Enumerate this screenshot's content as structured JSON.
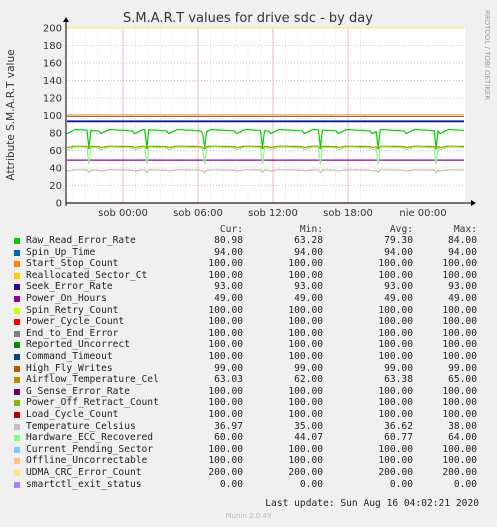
{
  "chart_data": {
    "type": "line",
    "title": "S.M.A.R.T values for drive sdc - by day",
    "ylabel": "Attribute S.M.A.R.T value",
    "side_label": "RRDTOOL / TOBI OETIKER",
    "ylim": [
      0,
      200
    ],
    "yticks": [
      "0",
      "20",
      "40",
      "60",
      "80",
      "100",
      "120",
      "140",
      "160",
      "180",
      "200"
    ],
    "xticks": [
      "sob 00:00",
      "sob 06:00",
      "sob 12:00",
      "sob 18:00",
      "nie 00:00"
    ],
    "grid": true,
    "legend_headers": [
      "Cur:",
      "Min:",
      "Avg:",
      "Max:"
    ],
    "series": [
      {
        "name": "Raw_Read_Error_Rate",
        "color": "#00cc00",
        "cur": "80.98",
        "min": "63.28",
        "avg": "79.30",
        "max": "84.00"
      },
      {
        "name": "Spin_Up_Time",
        "color": "#0066b3",
        "cur": "94.00",
        "min": "94.00",
        "avg": "94.00",
        "max": "94.00"
      },
      {
        "name": "Start_Stop_Count",
        "color": "#ff8000",
        "cur": "100.00",
        "min": "100.00",
        "avg": "100.00",
        "max": "100.00"
      },
      {
        "name": "Reallocated_Sector_Ct",
        "color": "#ffcc00",
        "cur": "100.00",
        "min": "100.00",
        "avg": "100.00",
        "max": "100.00"
      },
      {
        "name": "Seek_Error_Rate",
        "color": "#330099",
        "cur": "93.00",
        "min": "93.00",
        "avg": "93.00",
        "max": "93.00"
      },
      {
        "name": "Power_On_Hours",
        "color": "#990099",
        "cur": "49.00",
        "min": "49.00",
        "avg": "49.00",
        "max": "49.00"
      },
      {
        "name": "Spin_Retry_Count",
        "color": "#ccff00",
        "cur": "100.00",
        "min": "100.00",
        "avg": "100.00",
        "max": "100.00"
      },
      {
        "name": "Power_Cycle_Count",
        "color": "#ff0000",
        "cur": "100.00",
        "min": "100.00",
        "avg": "100.00",
        "max": "100.00"
      },
      {
        "name": "End_to_End_Error",
        "color": "#808080",
        "cur": "100.00",
        "min": "100.00",
        "avg": "100.00",
        "max": "100.00"
      },
      {
        "name": "Reported_Uncorrect",
        "color": "#008f00",
        "cur": "100.00",
        "min": "100.00",
        "avg": "100.00",
        "max": "100.00"
      },
      {
        "name": "Command_Timeout",
        "color": "#00487d",
        "cur": "100.00",
        "min": "100.00",
        "avg": "100.00",
        "max": "100.00"
      },
      {
        "name": "High_Fly_Writes",
        "color": "#b35a00",
        "cur": "99.00",
        "min": "99.00",
        "avg": "99.00",
        "max": "99.00"
      },
      {
        "name": "Airflow_Temperature_Cel",
        "color": "#b38f00",
        "cur": "63.03",
        "min": "62.00",
        "avg": "63.38",
        "max": "65.00"
      },
      {
        "name": "G_Sense_Error_Rate",
        "color": "#6b006b",
        "cur": "100.00",
        "min": "100.00",
        "avg": "100.00",
        "max": "100.00"
      },
      {
        "name": "Power_Off_Retract_Count",
        "color": "#8fb300",
        "cur": "100.00",
        "min": "100.00",
        "avg": "100.00",
        "max": "100.00"
      },
      {
        "name": "Load_Cycle_Count",
        "color": "#b30000",
        "cur": "100.00",
        "min": "100.00",
        "avg": "100.00",
        "max": "100.00"
      },
      {
        "name": "Temperature_Celsius",
        "color": "#bebebe",
        "cur": "36.97",
        "min": "35.00",
        "avg": "36.62",
        "max": "38.00"
      },
      {
        "name": "Hardware_ECC_Recovered",
        "color": "#80ff80",
        "cur": "60.00",
        "min": "44.07",
        "avg": "60.77",
        "max": "64.00"
      },
      {
        "name": "Current_Pending_Sector",
        "color": "#80c9ff",
        "cur": "100.00",
        "min": "100.00",
        "avg": "100.00",
        "max": "100.00"
      },
      {
        "name": "Offline_Uncorrectable",
        "color": "#ffc080",
        "cur": "100.00",
        "min": "100.00",
        "avg": "100.00",
        "max": "100.00"
      },
      {
        "name": "UDMA_CRC_Error_Count",
        "color": "#ffe680",
        "cur": "200.00",
        "min": "200.00",
        "avg": "200.00",
        "max": "200.00"
      },
      {
        "name": "smartctl_exit_status",
        "color": "#aa80ff",
        "cur": "0.00",
        "min": "0.00",
        "avg": "0.00",
        "max": "0.00"
      }
    ]
  },
  "footer": {
    "last_update": "Last update: Sun Aug 16 04:02:21 2020",
    "version": "Munin 2.0.49"
  }
}
